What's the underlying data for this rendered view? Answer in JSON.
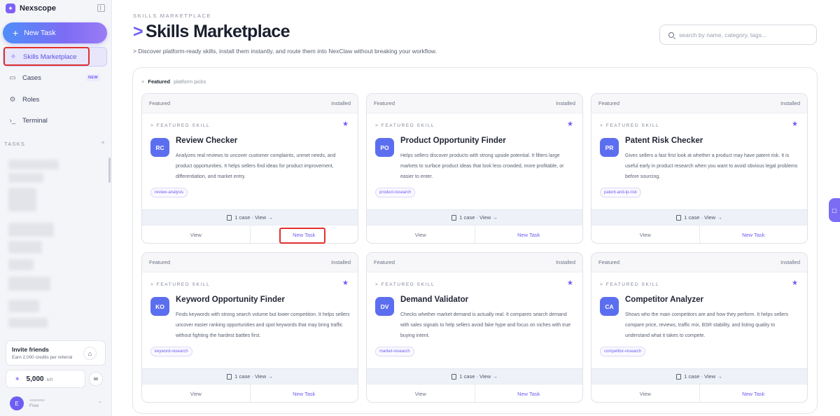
{
  "app": {
    "name": "Nexscope"
  },
  "sidebar": {
    "new_task": "New Task",
    "items": [
      {
        "label": "Skills Marketplace",
        "icon": "spark-icon"
      },
      {
        "label": "Cases",
        "icon": "book-icon",
        "badge": "NEW"
      },
      {
        "label": "Roles",
        "icon": "gear-icon"
      },
      {
        "label": "Terminal",
        "icon": "terminal-icon"
      }
    ],
    "tasks_label": "TASKS"
  },
  "invite": {
    "title": "Invite friends",
    "subtitle": "Earn 2,000 credits per referral"
  },
  "credits": {
    "value": "5,000",
    "suffix": "left"
  },
  "user": {
    "initial": "E",
    "plan": "Free"
  },
  "header": {
    "breadcrumb": "SKILLS.MARKETPLACE",
    "caret": ">",
    "title": "Skills Marketplace",
    "subtitle": "> Discover platform-ready skills, install them instantly, and route them into NexClaw without breaking your workflow.",
    "search_placeholder": "search by name, category, tags..."
  },
  "featured": {
    "label": "Featured",
    "sub": "platform picks"
  },
  "cards": [
    {
      "top_left": "Featured",
      "top_right": "Installed",
      "eyebrow": "> FEATURED SKILL",
      "initials": "RC",
      "name": "Review Checker",
      "desc": "Analyzes real reviews to uncover customer complaints, unmet needs, and product opportunities. It helps sellers find ideas for product improvement, differentiation, and market entry.",
      "tag": "review-analysis",
      "cases": "1 case · View →",
      "view": "View",
      "new_task": "New Task"
    },
    {
      "top_left": "Featured",
      "top_right": "Installed",
      "eyebrow": "> FEATURED SKILL",
      "initials": "PO",
      "name": "Product Opportunity Finder",
      "desc": "Helps sellers discover products with strong upside potential. It filters large markets to surface product ideas that look less crowded, more profitable, or easier to enter.",
      "tag": "product-research",
      "cases": "1 case · View →",
      "view": "View",
      "new_task": "New Task"
    },
    {
      "top_left": "Featured",
      "top_right": "Installed",
      "eyebrow": "> FEATURED SKILL",
      "initials": "PR",
      "name": "Patent Risk Checker",
      "desc": "Gives sellers a fast first look at whether a product may have patent risk. It is useful early in product research when you want to avoid obvious legal problems before sourcing.",
      "tag": "patent-and-ip-risk",
      "cases": "1 case · View →",
      "view": "View",
      "new_task": "New Task"
    },
    {
      "top_left": "Featured",
      "top_right": "Installed",
      "eyebrow": "> FEATURED SKILL",
      "initials": "KO",
      "name": "Keyword Opportunity Finder",
      "desc": "Finds keywords with strong search volume but lower competition. It helps sellers uncover easier ranking opportunities and spot keywords that may bring traffic without fighting the hardest battles first.",
      "tag": "keyword-research",
      "cases": "1 case · View →",
      "view": "View",
      "new_task": "New Task"
    },
    {
      "top_left": "Featured",
      "top_right": "Installed",
      "eyebrow": "> FEATURED SKILL",
      "initials": "DV",
      "name": "Demand Validator",
      "desc": "Checks whether market demand is actually real. It compares search demand with sales signals to help sellers avoid fake hype and focus on niches with true buying intent.",
      "tag": "market-research",
      "cases": "1 case · View →",
      "view": "View",
      "new_task": "New Task"
    },
    {
      "top_left": "Featured",
      "top_right": "Installed",
      "eyebrow": "> FEATURED SKILL",
      "initials": "CA",
      "name": "Competitor Analyzer",
      "desc": "Shows who the main competitors are and how they perform. It helps sellers compare price, reviews, traffic mix, BSR stability, and listing quality to understand what it takes to compete.",
      "tag": "competitor-research",
      "cases": "1 case · View →",
      "view": "View",
      "new_task": "New Task"
    }
  ],
  "colors": {
    "accent": "#6d5ef3",
    "highlight": "#e0302f"
  }
}
